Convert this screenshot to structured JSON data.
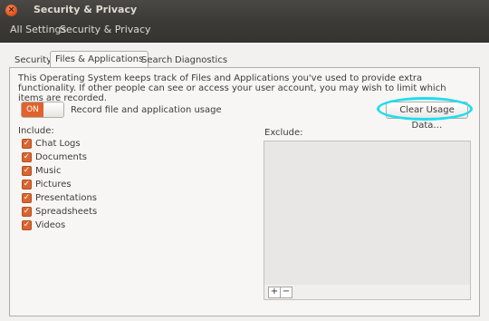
{
  "window": {
    "title": "Security & Privacy",
    "close_symbol": "×"
  },
  "toolbar": {
    "all_settings": "All Settings",
    "current": "Security & Privacy"
  },
  "tabs": [
    {
      "label": "Security"
    },
    {
      "label": "Files & Applications",
      "selected": true
    },
    {
      "label": "Search"
    },
    {
      "label": "Diagnostics"
    }
  ],
  "files": {
    "description": "This Operating System keeps track of Files and Applications you've used to provide extra functionality. If other people can see or access your user account, you may wish to limit which items are recorded.",
    "toggle_state": "ON",
    "toggle_label": "Record file and application usage",
    "clear_button": "Clear Usage Data…",
    "include_label": "Include:",
    "exclude_label": "Exclude:",
    "include_items": [
      {
        "label": "Chat Logs",
        "checked": true
      },
      {
        "label": "Documents",
        "checked": true
      },
      {
        "label": "Music",
        "checked": true
      },
      {
        "label": "Pictures",
        "checked": true
      },
      {
        "label": "Presentations",
        "checked": true
      },
      {
        "label": "Spreadsheets",
        "checked": true
      },
      {
        "label": "Videos",
        "checked": true
      }
    ],
    "add_symbol": "+",
    "remove_symbol": "−",
    "check_symbol": "✓"
  },
  "colors": {
    "accent": "#e0632e",
    "highlight": "#20dcec",
    "titlebar": "#3c3b37"
  }
}
